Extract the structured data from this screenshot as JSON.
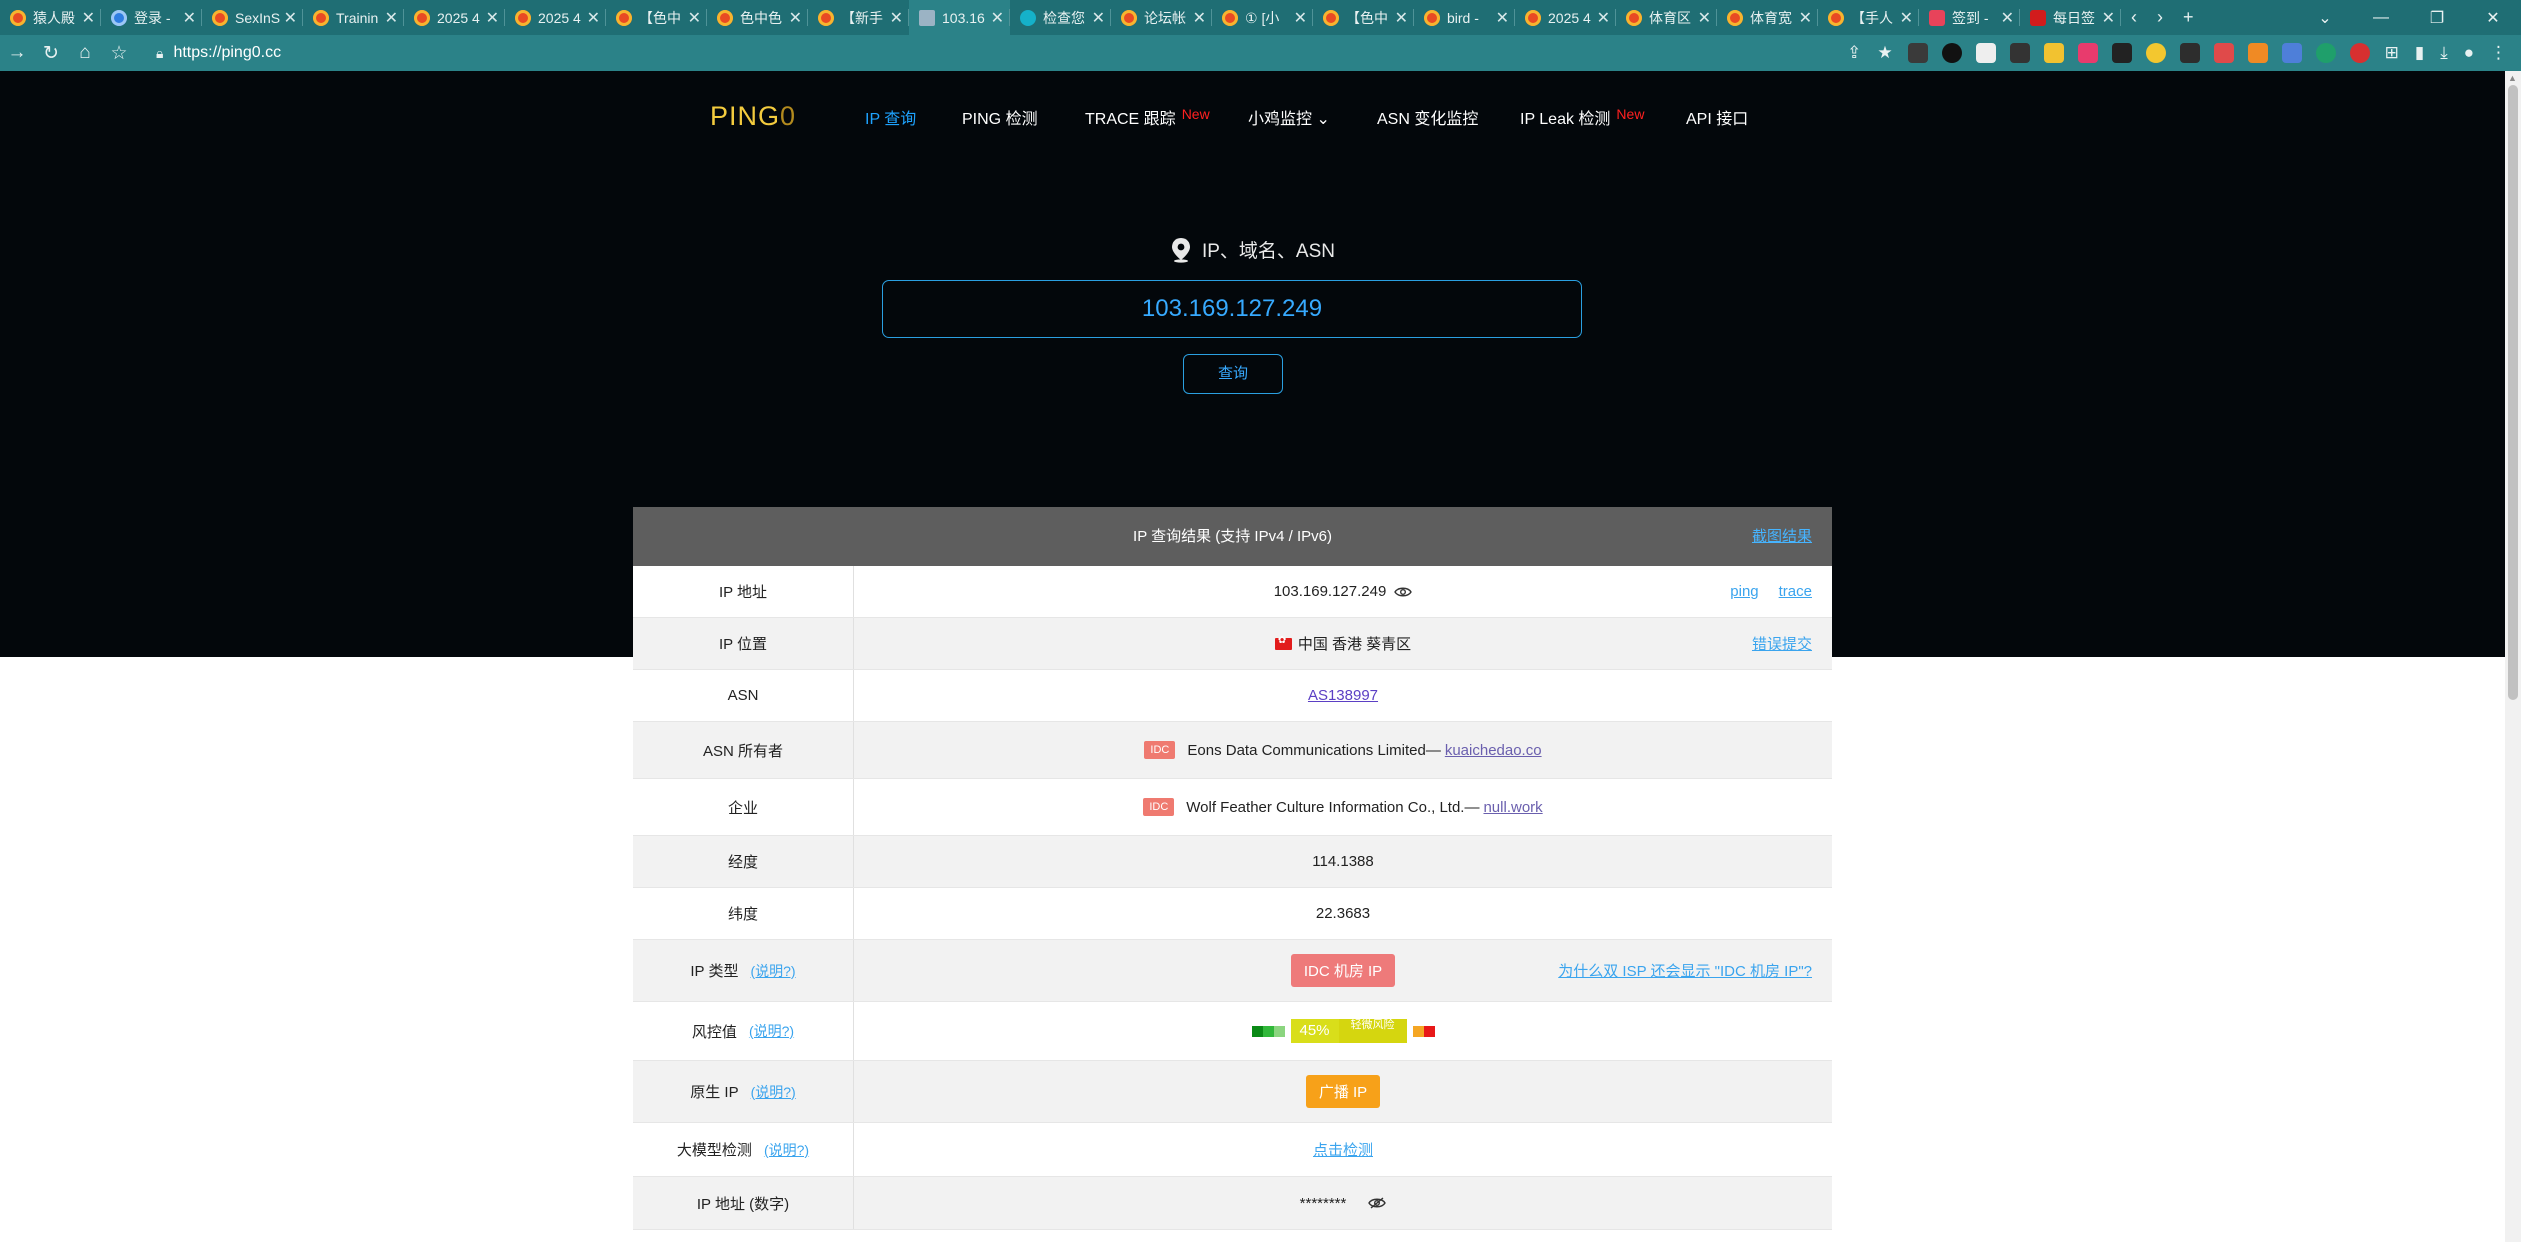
{
  "browser": {
    "tabs": [
      {
        "title": "猿人殿",
        "fav": ""
      },
      {
        "title": "登录 -",
        "fav": "blue"
      },
      {
        "title": "SexInS",
        "fav": ""
      },
      {
        "title": "Trainin",
        "fav": ""
      },
      {
        "title": "2025 4",
        "fav": ""
      },
      {
        "title": "2025 4",
        "fav": ""
      },
      {
        "title": "【色中",
        "fav": ""
      },
      {
        "title": "色中色",
        "fav": ""
      },
      {
        "title": "【新手",
        "fav": ""
      },
      {
        "title": "103.16",
        "fav": "doc",
        "active": true
      },
      {
        "title": "检查您",
        "fav": "w"
      },
      {
        "title": "论坛帐",
        "fav": ""
      },
      {
        "title": "① [小",
        "fav": ""
      },
      {
        "title": "【色中",
        "fav": ""
      },
      {
        "title": "bird - ",
        "fav": ""
      },
      {
        "title": "2025 4",
        "fav": ""
      },
      {
        "title": "体育区",
        "fav": ""
      },
      {
        "title": "体育宽",
        "fav": ""
      },
      {
        "title": "【手人",
        "fav": ""
      },
      {
        "title": "签到 -",
        "fav": "pink"
      },
      {
        "title": "每日签",
        "fav": "red"
      }
    ],
    "url": "https://ping0.cc"
  },
  "site": {
    "logo_main": "PING",
    "logo_zero": "0",
    "nav": [
      {
        "label": "IP 查询",
        "active": true
      },
      {
        "label": "PING 检测"
      },
      {
        "label": "TRACE 跟踪",
        "badge": "New"
      },
      {
        "label": "小鸡监控 ⌄"
      },
      {
        "label": "ASN 变化监控"
      },
      {
        "label": "IP Leak 检测",
        "badge": "New"
      },
      {
        "label": "API 接口"
      }
    ]
  },
  "search": {
    "label": "IP、域名、ASN",
    "value": "103.169.127.249",
    "button": "查询"
  },
  "result": {
    "title": "IP 查询结果 (支持 IPv4 / IPv6)",
    "screenshot_link": "截图结果",
    "help_text": "(说明?)",
    "ip_label": "IP 地址",
    "ip_value": "103.169.127.249",
    "ping_link": "ping",
    "trace_link": "trace",
    "location_label": "IP 位置",
    "location_value": "中国 香港 葵青区",
    "report_link": "错误提交",
    "asn_label": "ASN",
    "asn_value": "AS138997",
    "asn_owner_label": "ASN 所有者",
    "asn_owner_tag": "IDC",
    "asn_owner_value": "Eons Data Communications Limited—",
    "asn_owner_domain": "kuaichedao.co",
    "org_label": "企业",
    "org_tag": "IDC",
    "org_value": "Wolf Feather Culture Information Co., Ltd.—",
    "org_domain": "null.work",
    "lon_label": "经度",
    "lon_value": "114.1388",
    "lat_label": "纬度",
    "lat_value": "22.3683",
    "type_label": "IP 类型",
    "type_value": "IDC 机房 IP",
    "type_why": "为什么双 ISP 还会显示 \"IDC 机房 IP\"?",
    "risk_label": "风控值",
    "risk_percent": "45%",
    "risk_level": "轻微风险",
    "risk_value": 45,
    "native_label": "原生 IP",
    "native_value": "广播 IP",
    "llm_label": "大模型检测",
    "llm_value": "点击检测",
    "numeric_label": "IP 地址 (数字)",
    "numeric_value": "********"
  },
  "colors": {
    "accent": "#1ea3ff",
    "logo": "#f3cb3e",
    "new_badge": "#ff2020",
    "idc_badge": "#ee7a7a",
    "broadcast_badge": "#f7a119",
    "chrome": "#1f6e74"
  }
}
